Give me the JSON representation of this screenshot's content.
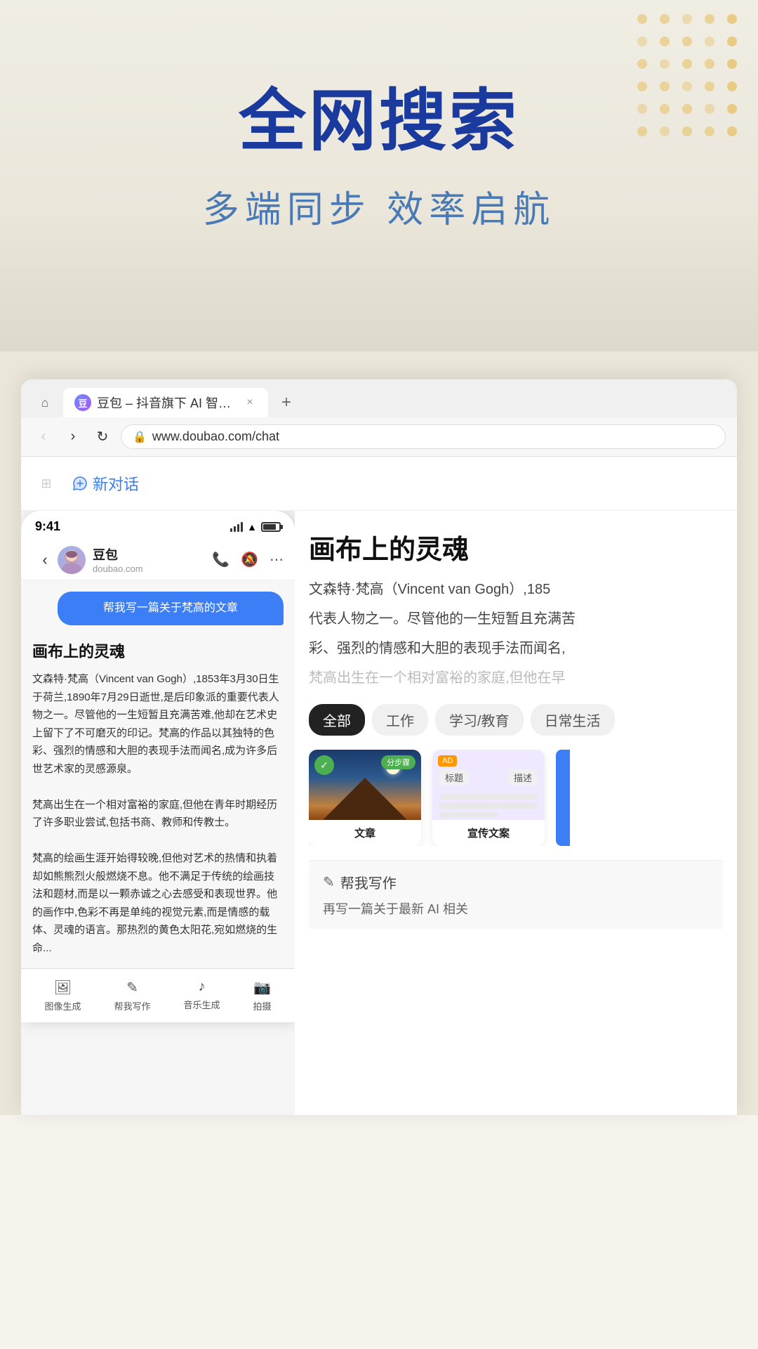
{
  "hero": {
    "title": "全网搜索",
    "subtitle": "多端同步 效率启航",
    "dots_rows": 6,
    "dots_cols": 5
  },
  "browser": {
    "tab_favicon_text": "豆",
    "tab_label": "豆包 – 抖音旗下 AI 智能助手",
    "tab_close_icon": "×",
    "tab_new_icon": "+",
    "home_icon": "⌂",
    "back_icon": "‹",
    "forward_icon": "›",
    "reload_icon": "↻",
    "address_lock_icon": "🔒",
    "address_url": "www.doubao.com/chat",
    "sidebar_toggle_icon": "⊞",
    "new_chat_label": "新对话",
    "new_chat_icon": "💬"
  },
  "phone": {
    "status_time": "9:41",
    "contact_name": "豆包",
    "contact_url": "doubao.com",
    "user_message": "帮我写一篇关于梵高的文章",
    "ai_title": "画布上的灵魂",
    "ai_text": "文森特·梵高（Vincent van Gogh）,1853年3月30日生于荷兰,1890年7月29日逝世,是后印象派的重要代表人物之一。尽管他的一生短暂且充满苦难,他却在艺术史上留下了不可磨灭的印记。梵高的作品以其独特的色彩、强烈的情感和大胆的表现手法而闻名,成为许多后世艺术家的灵感源泉。梵高出生在一个相对富裕的家庭,但他在青年时期经历了许多职业尝试,包括书商、教师和传教士。梵高的绘画生涯开始得较晚,但他对艺术的热情和执着却如熊熊烈火般燃烧不息。他不满足于传统的绘画技法和题材,而是以一颗赤诚之心去感受和表现世界。他的画作中,色彩不再是单纯的视觉元素,而是情感的载体、灵魂的语言。那热烈的黄色太阳花,宛如燃烧的生命...",
    "phone_actions": [
      "📞",
      "🔔",
      "⋯"
    ],
    "back_icon": "‹"
  },
  "desktop_right": {
    "article_title": "画布上的灵魂",
    "article_text1": "文森特·梵高（Vincent van Gogh）,185",
    "article_text2": "代表人物之一。尽管他的一生短暂且充满苦",
    "article_text3": "彩、强烈的情感和大胆的表现手法而闻名,",
    "article_text_fade": "梵高出生在一个相对富裕的家庭,但他在早",
    "category_tabs": [
      {
        "label": "全部",
        "active": true
      },
      {
        "label": "工作",
        "active": false
      },
      {
        "label": "学习/教育",
        "active": false
      },
      {
        "label": "日常生活",
        "active": false
      }
    ],
    "card1": {
      "badge": "分步骤",
      "title": "文章",
      "has_image": true
    },
    "card2": {
      "badge_ad": "AD",
      "label1": "标题",
      "label2": "描述",
      "title": "宣传文案"
    },
    "ai_help_icon": "✎",
    "ai_help_label": "帮我写作",
    "ai_rewrite_text": "再写一篇关于最新 AI 相关"
  },
  "bottom_bar": {
    "items": [
      {
        "icon": "🖼",
        "label": "图像生成"
      },
      {
        "icon": "✎",
        "label": "帮我写作"
      },
      {
        "icon": "♪",
        "label": "音乐生成"
      },
      {
        "icon": "📷",
        "label": "拍摄"
      }
    ]
  }
}
